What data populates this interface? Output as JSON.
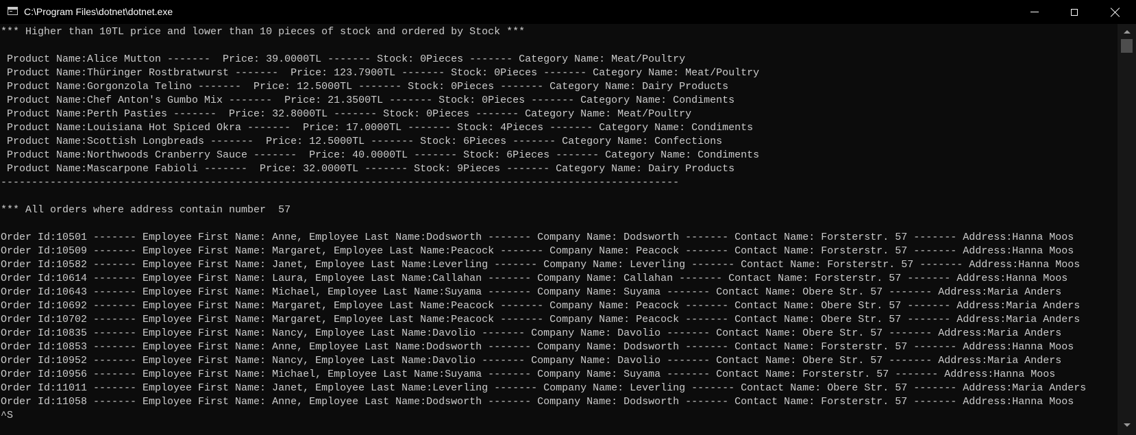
{
  "window": {
    "title": "C:\\Program Files\\dotnet\\dotnet.exe",
    "icon": "console-window-icon",
    "controls": {
      "minimize": "minimize-icon",
      "maximize": "maximize-icon",
      "close": "close-icon"
    }
  },
  "colors": {
    "background": "#0c0c0c",
    "titlebar": "#000000",
    "text": "#cccccc"
  },
  "console": {
    "lines": [
      "*** Higher than 10TL price and lower than 10 pieces of stock and ordered by Stock ***",
      "",
      " Product Name:Alice Mutton -------  Price: 39.0000TL ------- Stock: 0Pieces ------- Category Name: Meat/Poultry",
      " Product Name:Thüringer Rostbratwurst -------  Price: 123.7900TL ------- Stock: 0Pieces ------- Category Name: Meat/Poultry",
      " Product Name:Gorgonzola Telino -------  Price: 12.5000TL ------- Stock: 0Pieces ------- Category Name: Dairy Products",
      " Product Name:Chef Anton's Gumbo Mix -------  Price: 21.3500TL ------- Stock: 0Pieces ------- Category Name: Condiments",
      " Product Name:Perth Pasties -------  Price: 32.8000TL ------- Stock: 0Pieces ------- Category Name: Meat/Poultry",
      " Product Name:Louisiana Hot Spiced Okra -------  Price: 17.0000TL ------- Stock: 4Pieces ------- Category Name: Condiments",
      " Product Name:Scottish Longbreads -------  Price: 12.5000TL ------- Stock: 6Pieces ------- Category Name: Confections",
      " Product Name:Northwoods Cranberry Sauce -------  Price: 40.0000TL ------- Stock: 6Pieces ------- Category Name: Condiments",
      " Product Name:Mascarpone Fabioli -------  Price: 32.0000TL ------- Stock: 9Pieces ------- Category Name: Dairy Products",
      "--------------------------------------------------------------------------------------------------------------",
      "",
      "*** All orders where address contain number  57",
      "",
      "Order Id:10501 ------- Employee First Name: Anne, Employee Last Name:Dodsworth ------- Company Name: Dodsworth ------- Contact Name: Forsterstr. 57 ------- Address:Hanna Moos",
      "Order Id:10509 ------- Employee First Name: Margaret, Employee Last Name:Peacock ------- Company Name: Peacock ------- Contact Name: Forsterstr. 57 ------- Address:Hanna Moos",
      "Order Id:10582 ------- Employee First Name: Janet, Employee Last Name:Leverling ------- Company Name: Leverling ------- Contact Name: Forsterstr. 57 ------- Address:Hanna Moos",
      "Order Id:10614 ------- Employee First Name: Laura, Employee Last Name:Callahan ------- Company Name: Callahan ------- Contact Name: Forsterstr. 57 ------- Address:Hanna Moos",
      "Order Id:10643 ------- Employee First Name: Michael, Employee Last Name:Suyama ------- Company Name: Suyama ------- Contact Name: Obere Str. 57 ------- Address:Maria Anders",
      "Order Id:10692 ------- Employee First Name: Margaret, Employee Last Name:Peacock ------- Company Name: Peacock ------- Contact Name: Obere Str. 57 ------- Address:Maria Anders",
      "Order Id:10702 ------- Employee First Name: Margaret, Employee Last Name:Peacock ------- Company Name: Peacock ------- Contact Name: Obere Str. 57 ------- Address:Maria Anders",
      "Order Id:10835 ------- Employee First Name: Nancy, Employee Last Name:Davolio ------- Company Name: Davolio ------- Contact Name: Obere Str. 57 ------- Address:Maria Anders",
      "Order Id:10853 ------- Employee First Name: Anne, Employee Last Name:Dodsworth ------- Company Name: Dodsworth ------- Contact Name: Forsterstr. 57 ------- Address:Hanna Moos",
      "Order Id:10952 ------- Employee First Name: Nancy, Employee Last Name:Davolio ------- Company Name: Davolio ------- Contact Name: Obere Str. 57 ------- Address:Maria Anders",
      "Order Id:10956 ------- Employee First Name: Michael, Employee Last Name:Suyama ------- Company Name: Suyama ------- Contact Name: Forsterstr. 57 ------- Address:Hanna Moos",
      "Order Id:11011 ------- Employee First Name: Janet, Employee Last Name:Leverling ------- Company Name: Leverling ------- Contact Name: Obere Str. 57 ------- Address:Maria Anders",
      "Order Id:11058 ------- Employee First Name: Anne, Employee Last Name:Dodsworth ------- Company Name: Dodsworth ------- Contact Name: Forsterstr. 57 ------- Address:Hanna Moos",
      "^S"
    ]
  }
}
